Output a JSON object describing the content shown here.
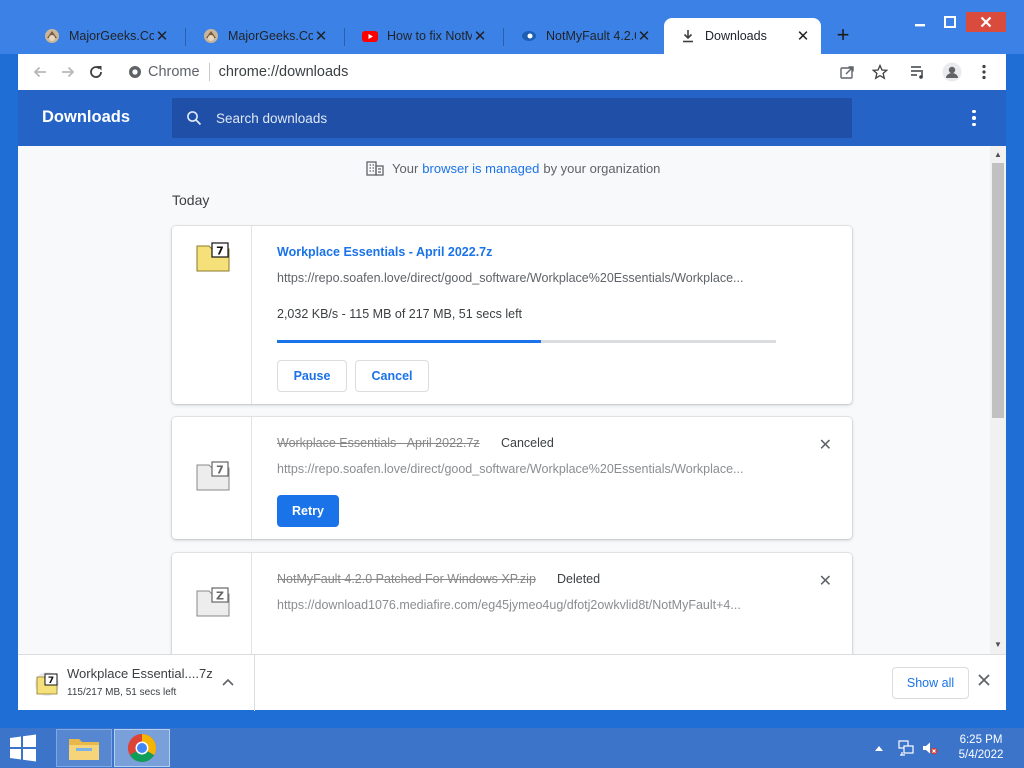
{
  "tabs": [
    {
      "title": "MajorGeeks.Com",
      "icon": "majorgeeks-icon"
    },
    {
      "title": "MajorGeeks.Com",
      "icon": "majorgeeks-icon"
    },
    {
      "title": "How to fix NotMy",
      "icon": "youtube-icon"
    },
    {
      "title": "NotMyFault 4.2.0",
      "icon": "softpedia-icon"
    },
    {
      "title": "Downloads",
      "icon": "download-icon"
    }
  ],
  "toolbar": {
    "site_label": "Chrome",
    "url": "chrome://downloads"
  },
  "header": {
    "title": "Downloads",
    "search_placeholder": "Search downloads"
  },
  "managed": {
    "prefix": "Your",
    "link": "browser is managed",
    "suffix": "by your organization"
  },
  "section": {
    "date": "Today"
  },
  "downloads": [
    {
      "name": "Workplace Essentials - April 2022.7z",
      "url": "https://repo.soafen.love/direct/good_software/Workplace%20Essentials/Workplace...",
      "progress_text": "2,032 KB/s - 115 MB of 217 MB, 51 secs left",
      "progress_fraction": 0.53,
      "pause_label": "Pause",
      "cancel_label": "Cancel"
    },
    {
      "name": "Workplace Essentials - April 2022.7z",
      "status": "Canceled",
      "url": "https://repo.soafen.love/direct/good_software/Workplace%20Essentials/Workplace...",
      "retry_label": "Retry",
      "remove_label": "✕"
    },
    {
      "name": "NotMyFault 4.2.0 Patched For Windows XP.zip",
      "status": "Deleted",
      "url": "https://download1076.mediafire.com/eg45jymeo4ug/dfotj2owkvlid8t/NotMyFault+4...",
      "remove_label": "✕"
    }
  ],
  "shelf": {
    "item_name": "Workplace Essential....7z",
    "item_status": "115/217 MB, 51 secs left",
    "show_all_label": "Show all"
  },
  "taskbar": {
    "time": "6:25 PM",
    "date": "5/4/2022"
  },
  "colors": {
    "accent": "#1a73e8",
    "header_bg": "#2563c7",
    "frame": "#3c82e6"
  }
}
